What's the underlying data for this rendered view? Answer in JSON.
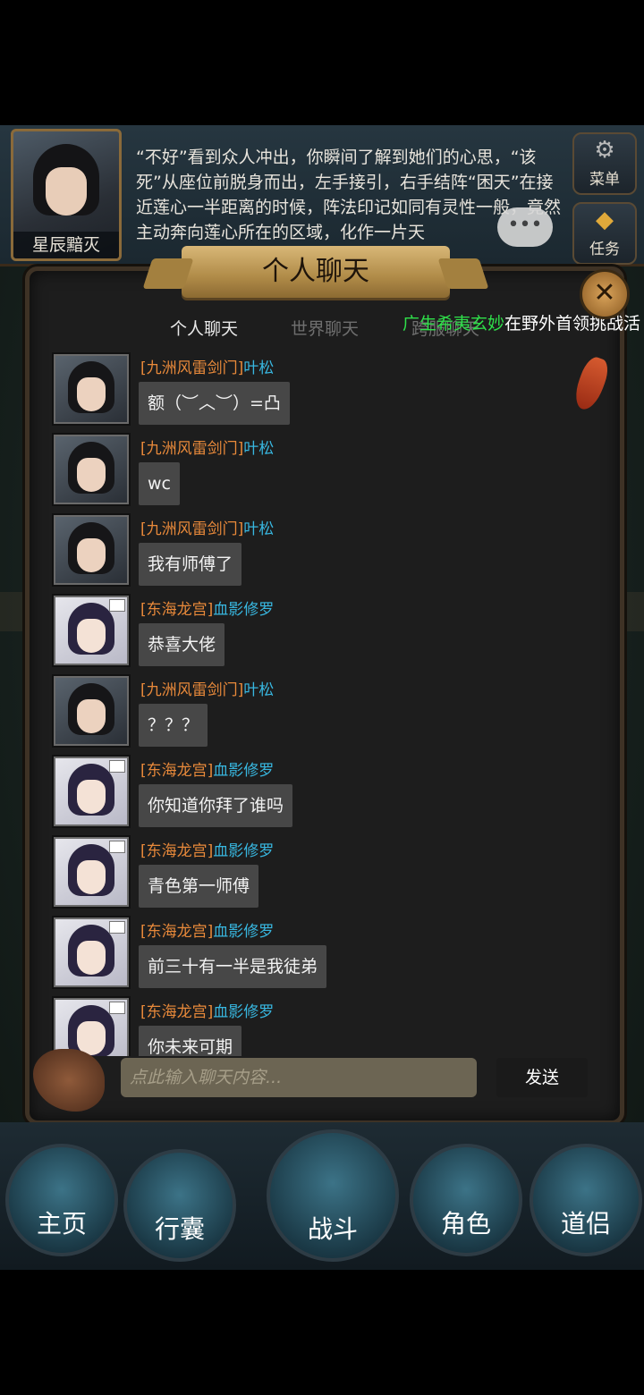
{
  "story": {
    "character_name": "星辰黯灭",
    "text": "“不好”看到众人冲出，你瞬间了解到她们的心思，“该死”从座位前脱身而出，左手接引，右手结阵“困天”在接近莲心一半距离的时候，阵法印记如同有灵性一般，竟然主动奔向莲心所在的区域，化作一片天"
  },
  "side_buttons": {
    "menu": "菜单",
    "tasks": "任务"
  },
  "panel": {
    "title": "个人聊天",
    "close_icon": "close-icon",
    "tabs": [
      "个人聊天",
      "世界聊天",
      "跨服聊天"
    ],
    "active_tab": 0,
    "broadcast": {
      "name": "广生希夷玄妙",
      "text": "在野外首领挑战活"
    }
  },
  "messages": [
    {
      "guild": "[九洲风雷剑门]",
      "sender": "叶松",
      "text": "额（︶︿︶）=凸",
      "avatar": "male"
    },
    {
      "guild": "[九洲风雷剑门]",
      "sender": "叶松",
      "text": "wc",
      "avatar": "male"
    },
    {
      "guild": "[九洲风雷剑门]",
      "sender": "叶松",
      "text": "我有师傅了",
      "avatar": "male"
    },
    {
      "guild": "[东海龙宫]",
      "sender": "血影修罗",
      "text": "恭喜大佬",
      "avatar": "female"
    },
    {
      "guild": "[九洲风雷剑门]",
      "sender": "叶松",
      "text": "？？？",
      "avatar": "male"
    },
    {
      "guild": "[东海龙宫]",
      "sender": "血影修罗",
      "text": "你知道你拜了谁吗",
      "avatar": "female"
    },
    {
      "guild": "[东海龙宫]",
      "sender": "血影修罗",
      "text": "青色第一师傅",
      "avatar": "female"
    },
    {
      "guild": "[东海龙宫]",
      "sender": "血影修罗",
      "text": "前三十有一半是我徒弟",
      "avatar": "female"
    },
    {
      "guild": "[东海龙宫]",
      "sender": "血影修罗",
      "text": "你未来可期",
      "avatar": "female"
    }
  ],
  "input": {
    "placeholder": "点此输入聊天内容...",
    "send_label": "发送"
  },
  "nav": {
    "home": "主页",
    "bag": "行囊",
    "battle": "战斗",
    "role": "角色",
    "companion": "道侣"
  }
}
